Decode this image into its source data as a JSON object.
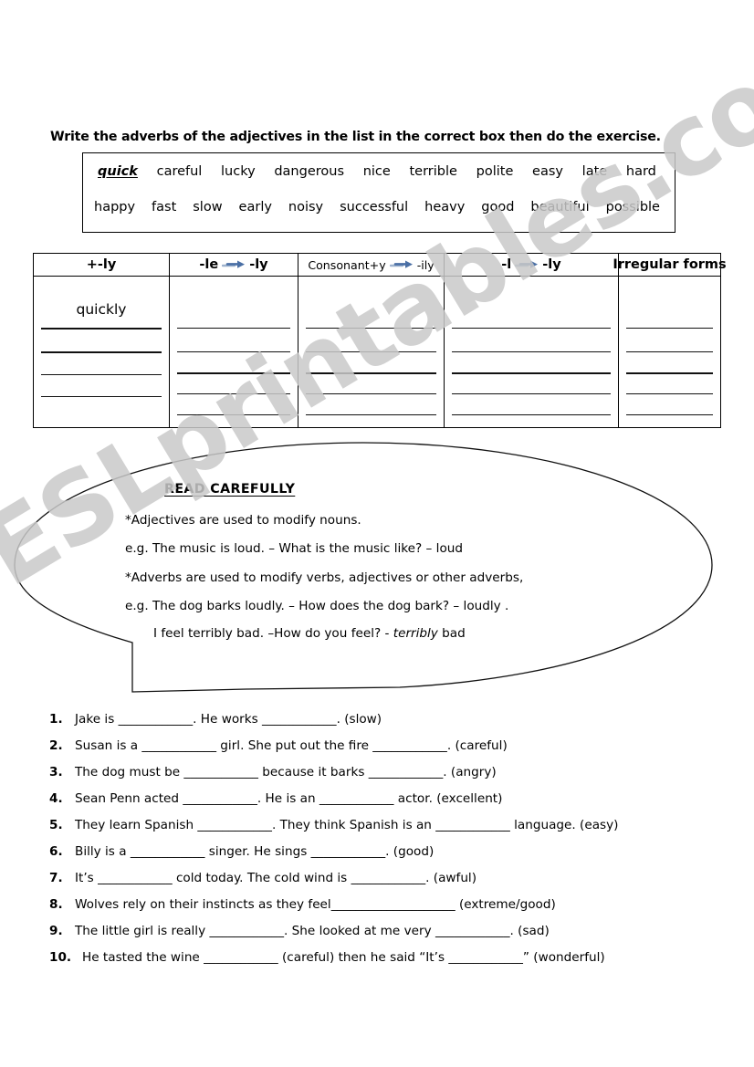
{
  "instruction": "Write the adverbs of the adjectives in the list in the correct box then do the exercise.",
  "word_bank": {
    "row1": [
      "quick",
      "careful",
      "lucky",
      "dangerous",
      "nice",
      "terrible",
      "polite",
      "easy",
      "late",
      "hard"
    ],
    "row2": [
      "happy",
      "fast",
      "slow",
      "early",
      "noisy",
      "successful",
      "heavy",
      "good",
      "beautiful",
      "possible"
    ],
    "example_word": "quick"
  },
  "table": {
    "columns": [
      {
        "head_left": "+-ly",
        "head_right": "",
        "has_arrow": false,
        "filled": "quickly",
        "blank_lines": 4
      },
      {
        "head_left": "-le",
        "head_right": "-ly",
        "has_arrow": true,
        "filled": "",
        "blank_lines": 5
      },
      {
        "head_left": "Consonant+y",
        "head_right": "-ily",
        "has_arrow": true,
        "filled": "",
        "blank_lines": 5
      },
      {
        "head_left": "-l",
        "head_right": "-ly",
        "has_arrow": true,
        "filled": "",
        "blank_lines": 5
      },
      {
        "head_left": "Irregular forms",
        "head_right": "",
        "has_arrow": false,
        "filled": "",
        "blank_lines": 5
      }
    ]
  },
  "bubble": {
    "title": "READ CAREFULLY",
    "line1": "*Adjectives are used to modify nouns.",
    "line2": "e.g. The music is loud. – What is the music like?  – loud",
    "line3": "*Adverbs are used to modify verbs, adjectives or other adverbs,",
    "line4": "e.g. The dog barks loudly. – How does the dog bark? – loudly  .",
    "line5_pre": "I feel terribly bad. –How do you feel?  - ",
    "line5_italic": "terribly",
    "line5_post": " bad"
  },
  "exercises": [
    {
      "num": "1.",
      "text": "Jake is  ____________. He works ____________.  (slow)"
    },
    {
      "num": "2.",
      "text": "Susan is a  ____________ girl. She put out the fire ____________.  (careful)"
    },
    {
      "num": "3.",
      "text": "The dog must be ____________ because it barks ____________.   (angry)"
    },
    {
      "num": "4.",
      "text": "Sean Penn acted ____________. He is an ____________ actor.  (excellent)"
    },
    {
      "num": "5.",
      "text": "They learn Spanish ____________. They think Spanish is an ____________ language.  (easy)"
    },
    {
      "num": "6.",
      "text": "Billy is a ____________ singer. He sings  ____________. (good)"
    },
    {
      "num": "7.",
      "text": "It’s ____________ cold today. The cold wind is ____________.  (awful)"
    },
    {
      "num": "8.",
      "text": "Wolves rely on their instincts as they feel____________________ (extreme/good)"
    },
    {
      "num": "9.",
      "text": "The little girl is really ____________. She looked at me very ____________. (sad)"
    },
    {
      "num": "10.",
      "text": "He tasted the wine ____________ (careful) then he said “It’s ____________” (wonderful)"
    }
  ],
  "watermark": {
    "text": "ESLprintables.com",
    "color": "#c9c9c9"
  },
  "colors": {
    "ink": "#000000",
    "arrow": "#4a6fa5",
    "arrow_tail": "#9fb3ce"
  }
}
